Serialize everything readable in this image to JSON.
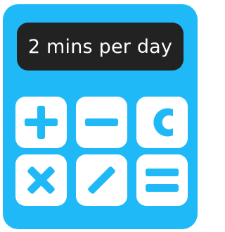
{
  "display": {
    "text": "2 mins per day"
  },
  "keys": [
    {
      "icon": "plus-icon"
    },
    {
      "icon": "minus-icon"
    },
    {
      "icon": "clear-c-icon"
    },
    {
      "icon": "multiply-icon"
    },
    {
      "icon": "divide-icon"
    },
    {
      "icon": "equals-icon"
    }
  ],
  "colors": {
    "body": "#1fb9f7",
    "display_bg": "#222222",
    "display_text": "#ffffff",
    "key_bg": "#ffffff",
    "key_symbol": "#1fb9f7"
  }
}
